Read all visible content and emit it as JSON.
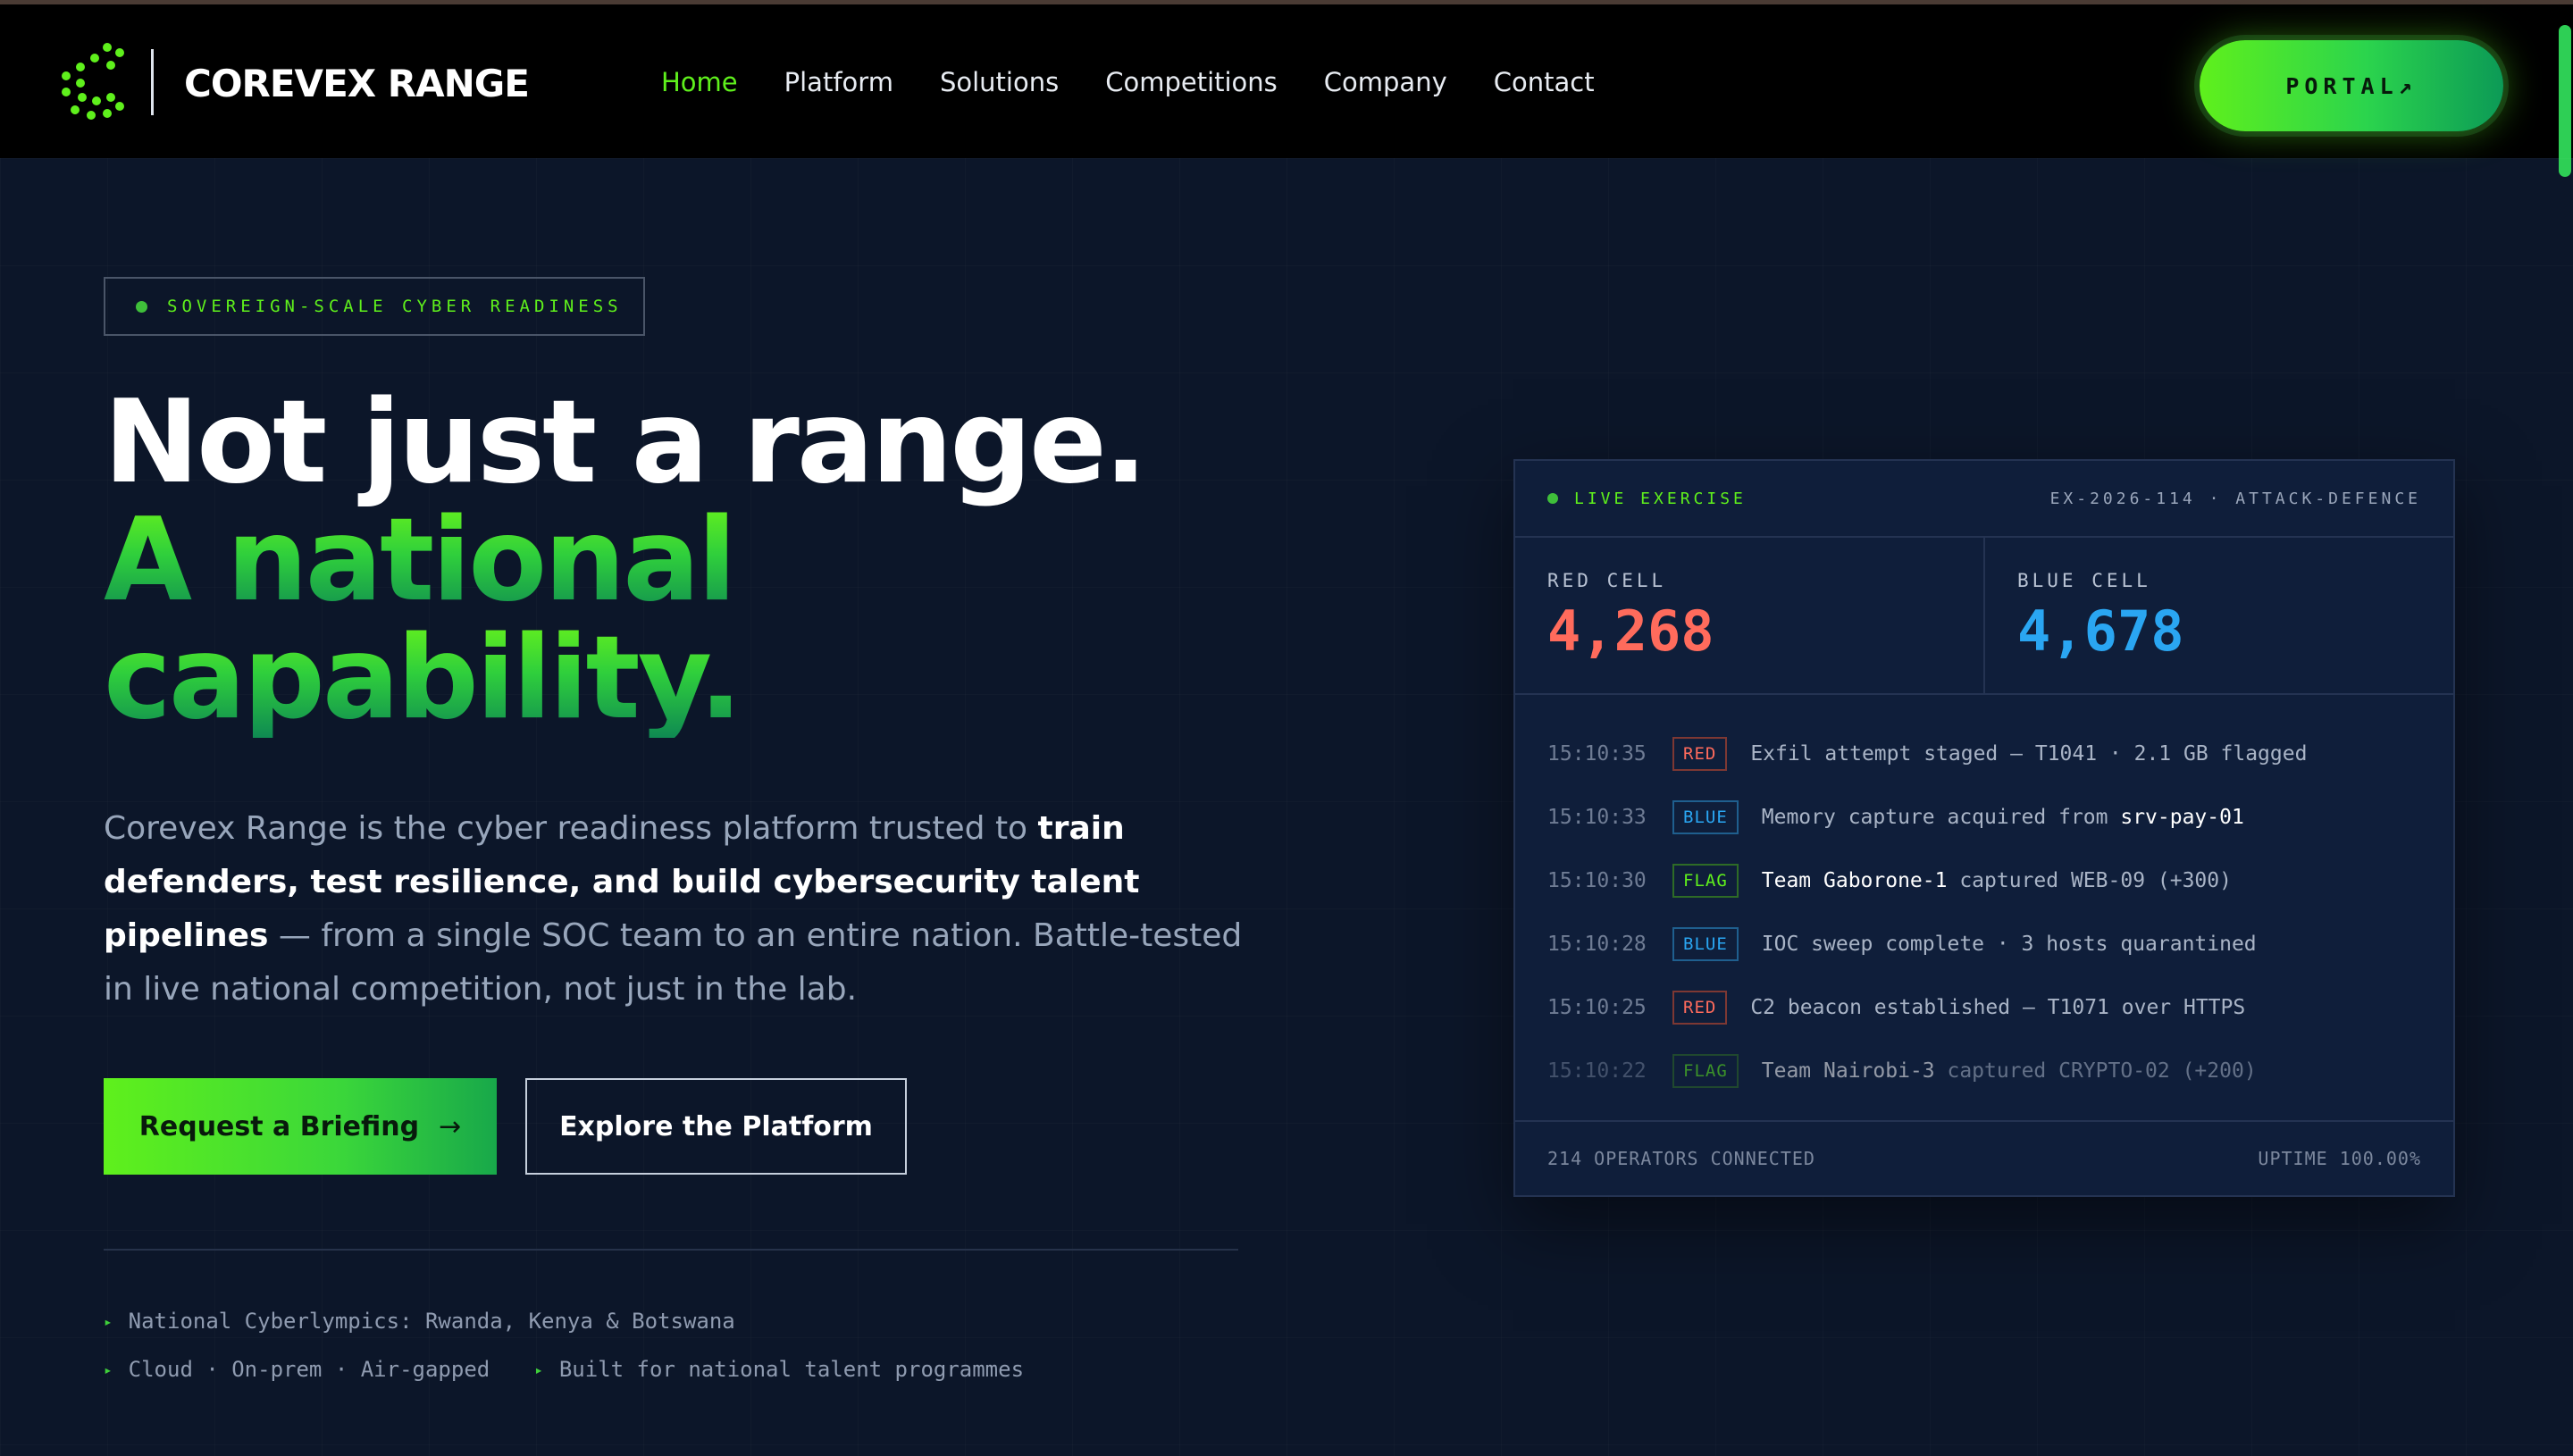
{
  "brand": {
    "name_main": "COREVEX",
    "name_accent": "",
    "name_suffix": "RANGE"
  },
  "nav": {
    "links": [
      "Home",
      "Platform",
      "Solutions",
      "Competitions",
      "Company",
      "Contact"
    ],
    "active": "Home",
    "portal_label": "PORTAL↗"
  },
  "hero": {
    "badge": "SOVEREIGN-SCALE CYBER READINESS",
    "headline_line1": "Not just a range.",
    "headline_line2": "A national",
    "headline_line3": "capability.",
    "lead_pre": "Corevex Range is the cyber readiness platform trusted to ",
    "lead_bold": "train defenders, test resilience, and build cybersecurity talent pipelines",
    "lead_post": " — from a single SOC team to an entire nation. Battle-tested in live national competition, not just in the lab.",
    "cta_primary": "Request a Briefing",
    "cta_primary_arrow": "→",
    "cta_secondary": "Explore the Platform",
    "bullets_row1": [
      "National Cyberlympics: Rwanda, Kenya & Botswana"
    ],
    "bullets_row2": [
      "Cloud · On-prem · Air-gapped",
      "Built for national talent programmes"
    ]
  },
  "panel": {
    "live_label": "LIVE EXERCISE",
    "exercise_id": "EX-2026-114 · ATTACK-DEFENCE",
    "red_label": "RED CELL",
    "red_score": "4,268",
    "blue_label": "BLUE CELL",
    "blue_score": "4,678",
    "feed": [
      {
        "time": "15:10:35",
        "tag": "RED",
        "pre": "Exfil attempt staged — T1041 · 2.1 GB flagged",
        "hl": "",
        "post": ""
      },
      {
        "time": "15:10:33",
        "tag": "BLUE",
        "pre": "Memory capture acquired from ",
        "hl": "srv-pay-01",
        "post": ""
      },
      {
        "time": "15:10:30",
        "tag": "FLAG",
        "pre": "",
        "hl": "Team Gaborone-1",
        "post": " captured WEB-09 (+300)"
      },
      {
        "time": "15:10:28",
        "tag": "BLUE",
        "pre": "IOC sweep complete · 3 hosts quarantined",
        "hl": "",
        "post": ""
      },
      {
        "time": "15:10:25",
        "tag": "RED",
        "pre": "C2 beacon established — T1071 over HTTPS",
        "hl": "",
        "post": ""
      },
      {
        "time": "15:10:22",
        "tag": "FLAG",
        "pre": "",
        "hl": "Team Nairobi-3",
        "post": " captured CRYPTO-02 (+200)"
      }
    ],
    "footer_left": "214 OPERATORS CONNECTED",
    "footer_right": "UPTIME 100.00%"
  },
  "colors": {
    "accent": "#5ff01c",
    "red": "#ff6b5c",
    "blue": "#2aa6f2",
    "bg": "#0c1629"
  }
}
